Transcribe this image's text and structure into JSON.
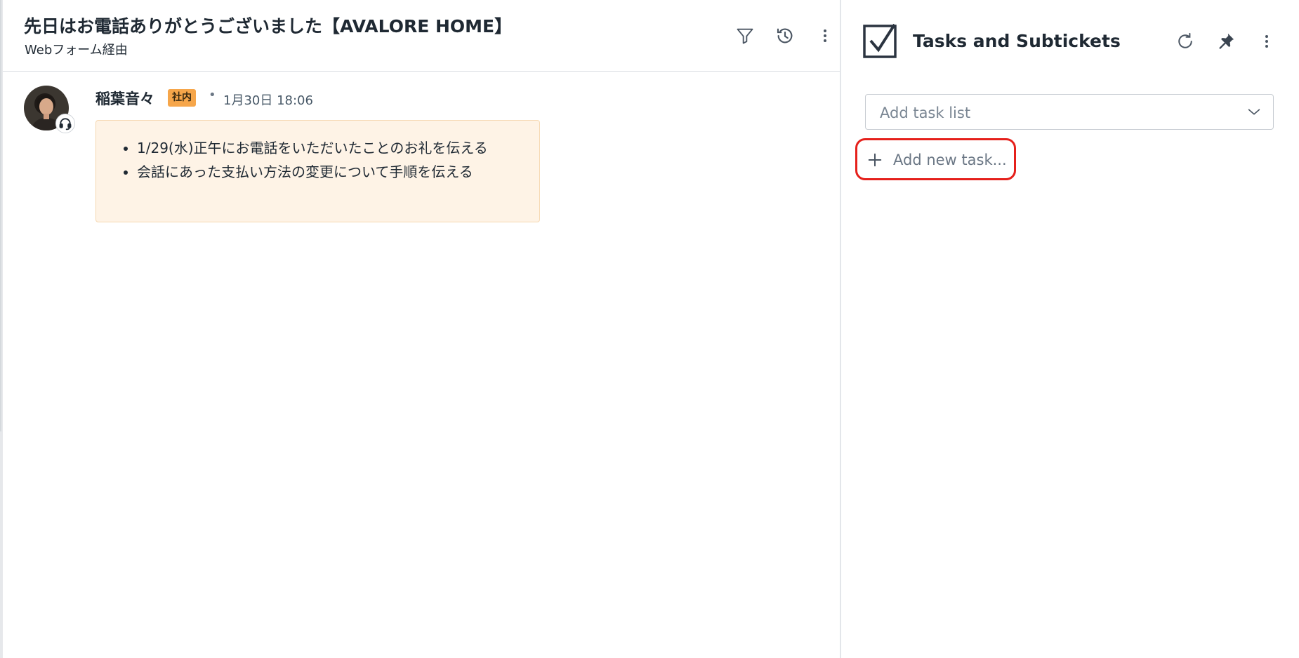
{
  "ticket": {
    "title": "先日はお電話ありがとうございました【AVALORE HOME】",
    "subtitle": "Webフォーム経由",
    "header_icons": [
      "filter-icon",
      "history-icon",
      "more-vertical-icon"
    ]
  },
  "message": {
    "author": "稲葉音々",
    "badge": "社内",
    "separator": "•",
    "timestamp": "1月30日 18:06",
    "items": [
      "1/29(水)正午にお電話をいただいたことのお礼を伝える",
      "会話にあった支払い方法の変更について手順を伝える"
    ]
  },
  "tasks_panel": {
    "title": "Tasks and Subtickets",
    "header_icons": [
      "refresh-icon",
      "pin-icon",
      "more-vertical-icon"
    ],
    "task_list_select": {
      "placeholder": "Add task list"
    },
    "add_task": {
      "label": "Add new task..."
    }
  },
  "colors": {
    "note_background": "#fef3e6",
    "badge_background": "#f6a64a",
    "highlight_outline": "#e5201b",
    "text_primary": "#1f2933"
  }
}
